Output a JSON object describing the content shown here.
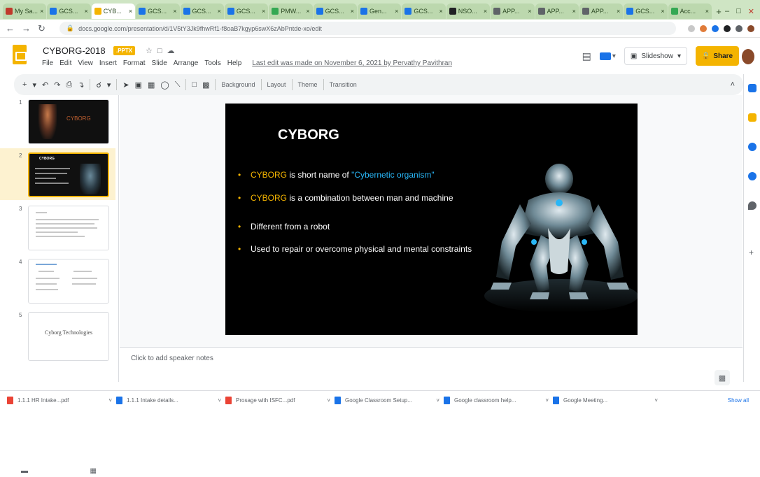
{
  "browser": {
    "tabs": [
      {
        "label": "My Sa...",
        "color": "#c0392b",
        "active": false
      },
      {
        "label": "GCS...",
        "color": "#1a73e8",
        "active": false
      },
      {
        "label": "CYB...",
        "color": "#f4b400",
        "active": true
      },
      {
        "label": "GCS...",
        "color": "#1a73e8",
        "active": false
      },
      {
        "label": "GCS...",
        "color": "#1a73e8",
        "active": false
      },
      {
        "label": "GCS...",
        "color": "#1a73e8",
        "active": false
      },
      {
        "label": "PMW...",
        "color": "#34a853",
        "active": false
      },
      {
        "label": "GCS...",
        "color": "#1a73e8",
        "active": false
      },
      {
        "label": "Gen...",
        "color": "#1a73e8",
        "active": false
      },
      {
        "label": "GCS...",
        "color": "#1a73e8",
        "active": false
      },
      {
        "label": "NSO...",
        "color": "#202124",
        "active": false
      },
      {
        "label": "APP...",
        "color": "#5f6368",
        "active": false
      },
      {
        "label": "APP...",
        "color": "#5f6368",
        "active": false
      },
      {
        "label": "APP...",
        "color": "#5f6368",
        "active": false
      },
      {
        "label": "GCS...",
        "color": "#1a73e8",
        "active": false
      },
      {
        "label": "Acc...",
        "color": "#34a853",
        "active": false
      }
    ],
    "new_tab": "+",
    "url": "docs.google.com/presentation/d/1V5tY3Jk9fhwRf1-f8oaB7kgyp6swX6zAbPntde-xo/edit"
  },
  "doc": {
    "title": "CYBORG-2018",
    "badge": ".PPTX",
    "menu": [
      "File",
      "Edit",
      "View",
      "Insert",
      "Format",
      "Slide",
      "Arrange",
      "Tools",
      "Help"
    ],
    "last_edit": "Last edit was made on November 6, 2021 by Pervathy Pavithran",
    "slideshow_label": "Slideshow",
    "share_label": "Share"
  },
  "toolbar": {
    "background_label": "Background",
    "layout_label": "Layout",
    "theme_label": "Theme",
    "transition_label": "Transition"
  },
  "filmstrip": {
    "slides": [
      {
        "num": "1",
        "thumb_title": "CYBORG"
      },
      {
        "num": "2",
        "thumb_title": "CYBORG"
      },
      {
        "num": "3",
        "thumb_title": ""
      },
      {
        "num": "4",
        "thumb_title": ""
      },
      {
        "num": "5",
        "thumb_title": "Cyborg Technologies"
      }
    ]
  },
  "slide": {
    "title": "CYBORG",
    "bullets": [
      {
        "parts": [
          {
            "t": "CYBORG",
            "c": "y"
          },
          {
            "t": " is short name of ",
            "c": ""
          },
          {
            "t": "\"Cybernetic organism\"",
            "c": "b"
          }
        ]
      },
      {
        "parts": [
          {
            "t": "CYBORG",
            "c": "y"
          },
          {
            "t": " is a combination between man and machine",
            "c": ""
          }
        ]
      },
      {
        "parts": [
          {
            "t": "Different from a robot",
            "c": ""
          }
        ]
      },
      {
        "parts": [
          {
            "t": "Used to repair or overcome physical and mental constraints",
            "c": ""
          }
        ]
      }
    ]
  },
  "notes": {
    "placeholder": "Click to add speaker notes"
  },
  "downloads": {
    "items": [
      {
        "name": "1.1.1 HR Intake...pdf",
        "color": "#ea4335"
      },
      {
        "name": "1.1.1 Intake details...",
        "color": "#1a73e8"
      },
      {
        "name": "Prosage with ISFC...pdf",
        "color": "#ea4335"
      },
      {
        "name": "Google Classroom Setup...",
        "color": "#1a73e8"
      },
      {
        "name": "Google classroom help...",
        "color": "#1a73e8"
      },
      {
        "name": "Google Meeting...",
        "color": "#1a73e8"
      }
    ],
    "show_all": "Show all"
  }
}
